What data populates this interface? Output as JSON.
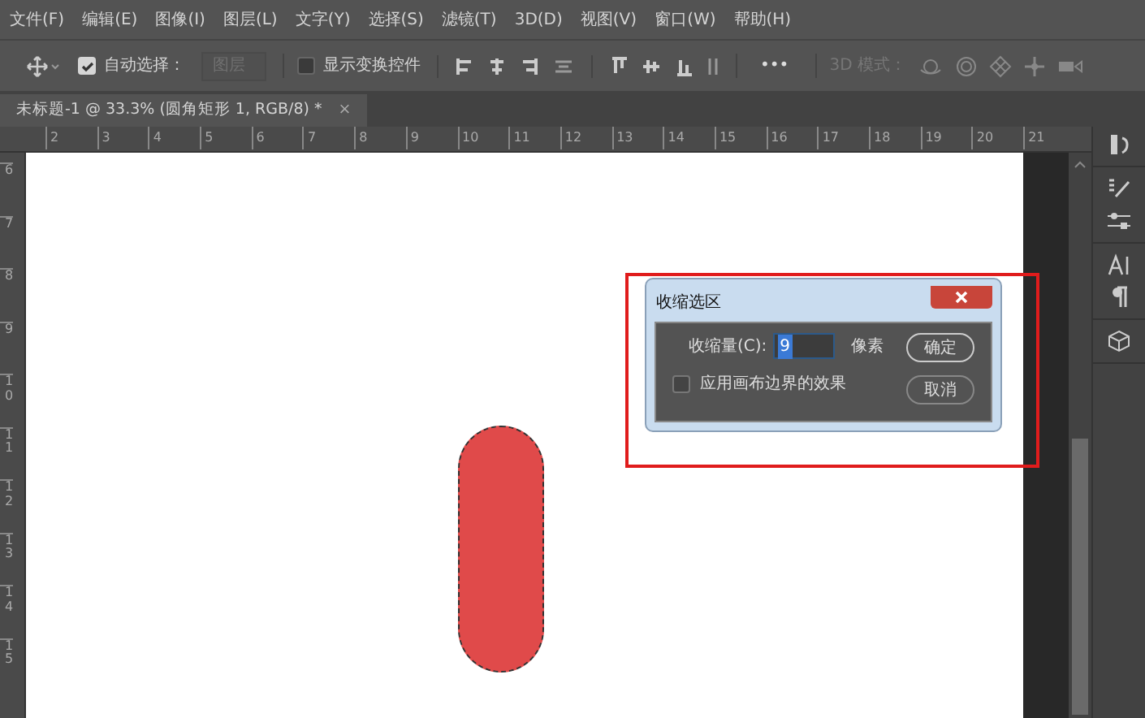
{
  "menu": [
    "文件(F)",
    "编辑(E)",
    "图像(I)",
    "图层(L)",
    "文字(Y)",
    "选择(S)",
    "滤镜(T)",
    "3D(D)",
    "视图(V)",
    "窗口(W)",
    "帮助(H)"
  ],
  "toolbar": {
    "auto_select": {
      "label": "自动选择：",
      "checked": true
    },
    "layer_dropdown": {
      "value": "图层",
      "disabled": true
    },
    "show_transform": {
      "label": "显示变换控件",
      "checked": false
    },
    "more": "•••",
    "mode_3d_label": "3D 模式："
  },
  "document_tab": {
    "title": "未标题-1 @ 33.3% (圆角矩形 1, RGB/8) *",
    "close": "×"
  },
  "ruler": {
    "horizontal": [
      "2",
      "3",
      "4",
      "5",
      "6",
      "7",
      "8",
      "9",
      "10",
      "11",
      "12",
      "13",
      "14",
      "15",
      "16",
      "17",
      "18",
      "19",
      "20",
      "21"
    ],
    "vertical": [
      "6",
      "7",
      "8",
      "9",
      "10",
      "11",
      "12",
      "13",
      "14",
      "15"
    ]
  },
  "dialog": {
    "title": "收缩选区",
    "field_label": "收缩量(C):",
    "value": "9",
    "value_selected": true,
    "unit": "像素",
    "checkbox": {
      "label": "应用画布边界的效果",
      "checked": false
    },
    "buttons": [
      "确定",
      "取消"
    ]
  }
}
